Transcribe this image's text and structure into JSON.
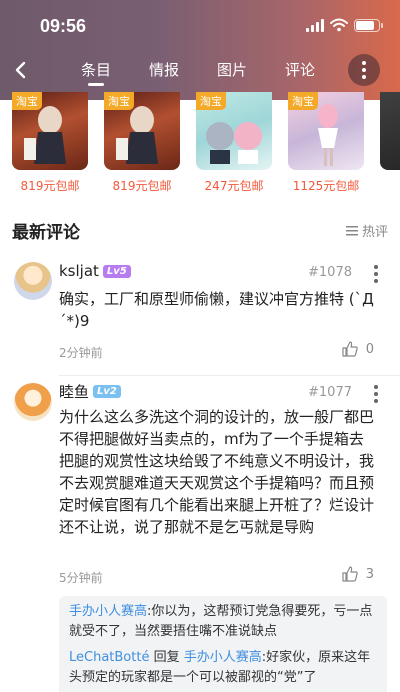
{
  "status_bar": {
    "time": "09:56"
  },
  "nav": {
    "tabs": [
      {
        "label": "条目",
        "active": true
      },
      {
        "label": "情报",
        "active": false
      },
      {
        "label": "图片",
        "active": false
      },
      {
        "label": "评论",
        "active": false
      }
    ]
  },
  "products": [
    {
      "tag": "淘宝",
      "price": "819元包邮"
    },
    {
      "tag": "淘宝",
      "price": "819元包邮"
    },
    {
      "tag": "淘宝",
      "price": "247元包邮"
    },
    {
      "tag": "淘宝",
      "price": "1125元包邮"
    }
  ],
  "section": {
    "title": "最新评论",
    "sort_label": "热评"
  },
  "comments": [
    {
      "user": "ksljat",
      "level": "Lv5",
      "floor": "#1078",
      "text": "确实，工厂和原型师偷懒，建议冲官方推特 (`Д´*)9",
      "time": "2分钟前",
      "likes": "0"
    },
    {
      "user": "睦鱼",
      "level": "Lv2",
      "floor": "#1077",
      "text": "为什么这么多洗这个洞的设计的，放一般厂都巴不得把腿做好当卖点的，mf为了一个手提箱去把腿的观赏性这块给毁了不纯意义不明设计，我不去观赏腿难道天天观赏这个手提箱吗？而且预定时候官图有几个能看出来腿上开桩了？烂设计还不让说，说了那就不是乞丐就是导购",
      "time": "5分钟前",
      "likes": "3"
    }
  ],
  "replies": [
    {
      "name": "手办小人赛高",
      "text": ":你以为，这帮预订党急得要死，亏一点就受不了，当然要捂住嘴不准说缺点"
    },
    {
      "name": "LeChatBotté",
      "reply_word": " 回复 ",
      "to": "手办小人赛高",
      "text": ":好家伙，原来这年头预定的玩家都是一个可以被鄙视的“党”了"
    }
  ],
  "colors": {
    "accent_blue": "#3f8fe0",
    "price_red": "#f2583a",
    "tag_orange": "#f4a928"
  }
}
